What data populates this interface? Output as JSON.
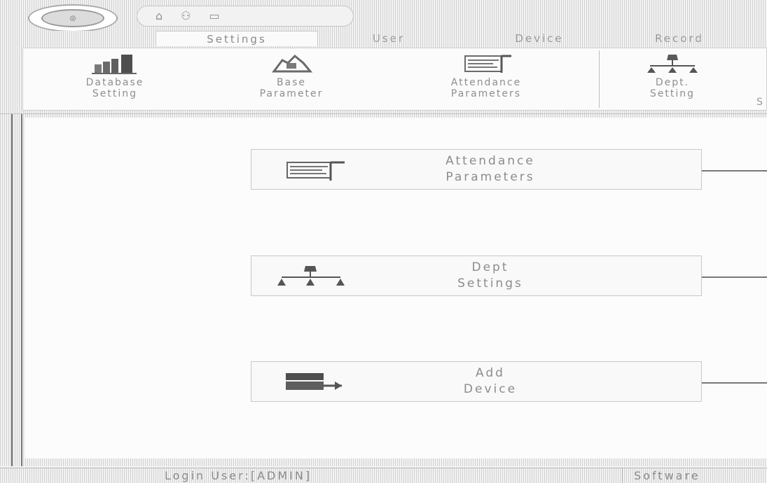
{
  "tabs": [
    {
      "label": "Settings",
      "active": true
    },
    {
      "label": "User",
      "active": false
    },
    {
      "label": "Device",
      "active": false
    },
    {
      "label": "Record",
      "active": false
    }
  ],
  "ribbon": {
    "buttons": [
      {
        "label": "Database\nSetting",
        "icon": "database-icon"
      },
      {
        "label": "Base\nParameter",
        "icon": "cloud-parameter-icon"
      },
      {
        "label": "Attendance\nParameters",
        "icon": "attendance-card-icon"
      },
      {
        "label": "Dept.\nSetting",
        "icon": "department-tree-icon"
      }
    ],
    "trailing_char": "S"
  },
  "flow": [
    {
      "label": "Attendance\nParameters",
      "icon": "attendance-card-icon"
    },
    {
      "label": "Dept\nSettings",
      "icon": "department-tree-icon"
    },
    {
      "label": "Add\nDevice",
      "icon": "add-device-icon"
    }
  ],
  "status": {
    "login_user": "Login User:[ADMIN]",
    "software": "Software"
  },
  "colors": {
    "line": "#777777",
    "border": "#c8c8c8",
    "text": "#8a8a8a"
  }
}
